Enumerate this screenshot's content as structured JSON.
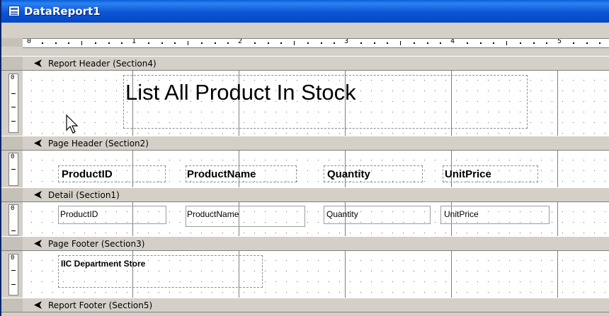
{
  "window": {
    "title": "DataReport1"
  },
  "ruler": {
    "numbers": [
      "0",
      "1",
      "2",
      "3",
      "4",
      "5"
    ]
  },
  "vruler_label": "0",
  "sections": {
    "report_header": {
      "label": "Report Header (Section4)",
      "title_label": "List All Product In Stock"
    },
    "page_header": {
      "label": "Page Header (Section2)",
      "captions": [
        "ProductID",
        "ProductName",
        "Quantity",
        "UnitPrice"
      ]
    },
    "detail": {
      "label": "Detail (Section1)",
      "fields": [
        "ProductID",
        "ProductName",
        "Quantity",
        "UnitPrice"
      ]
    },
    "page_footer": {
      "label": "Page Footer (Section3)",
      "store_label": "IIC Department Store"
    },
    "report_footer": {
      "label": "Report Footer (Section5)"
    }
  },
  "icons": {
    "window": "report-window-icon",
    "section": "section-arrow-icon",
    "cursor": "mouse-pointer-icon"
  },
  "colors": {
    "title_bar": "#0c55d6",
    "face": "#d4d0c8",
    "canvas": "#ffffff"
  }
}
